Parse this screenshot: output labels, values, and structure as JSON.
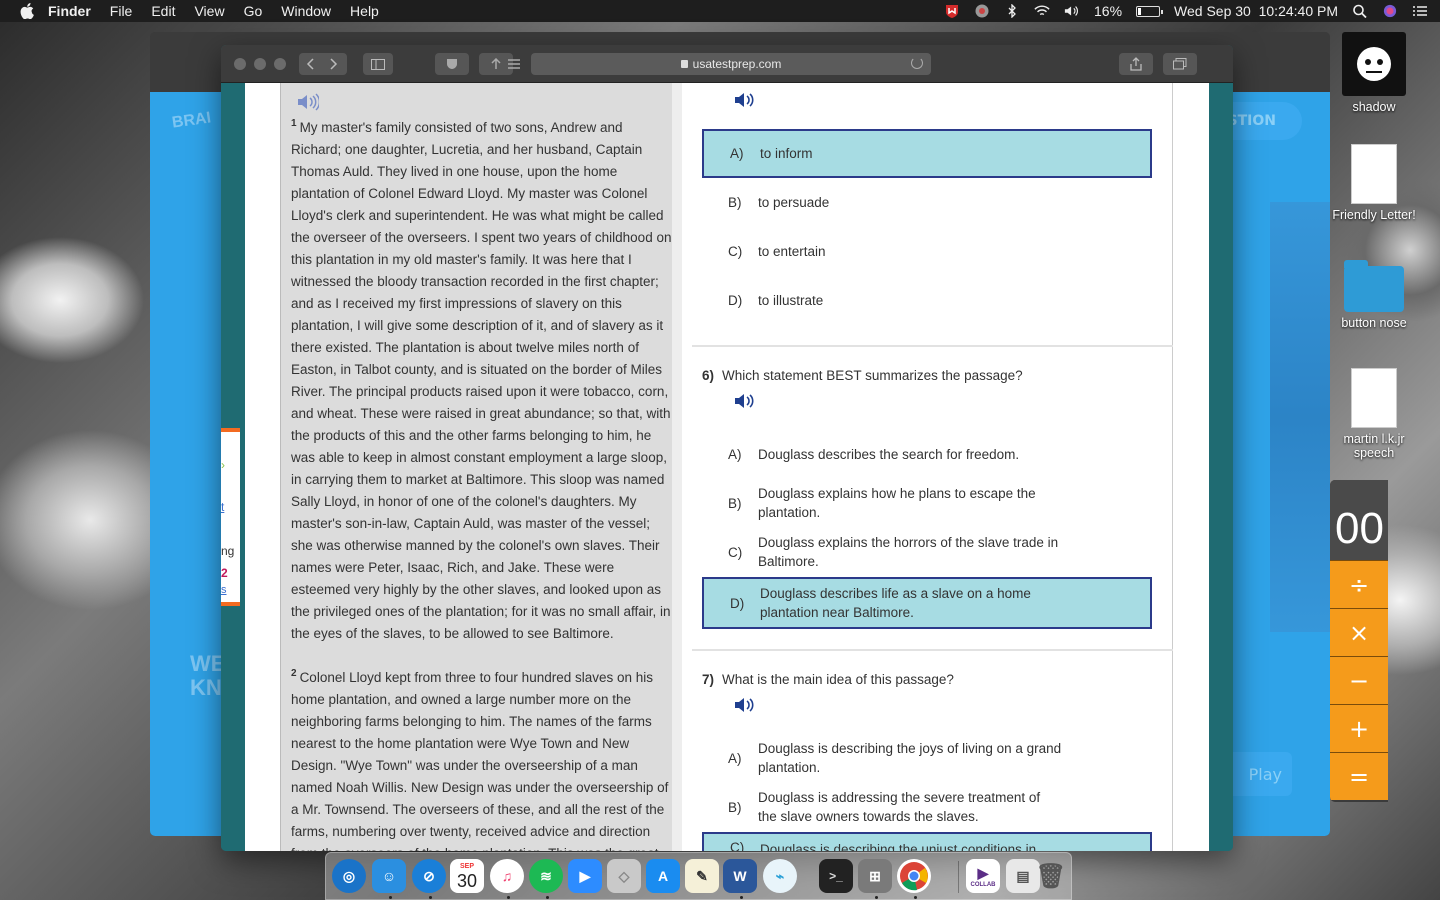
{
  "menubar": {
    "app_name": "Finder",
    "items": [
      "File",
      "Edit",
      "View",
      "Go",
      "Window",
      "Help"
    ],
    "battery_percent": "16%",
    "battery_level": 0.16,
    "datetime": "Wed Sep 30  10:24:40 PM"
  },
  "browser": {
    "url": "usatestprep.com"
  },
  "back_page": {
    "brand": "BRAI",
    "question_button": "ESTION",
    "wk_text": "WE\nKN",
    "play_text": "Play"
  },
  "side_tab": {
    "lines": [
      "ng",
      "2",
      "s"
    ]
  },
  "passage": {
    "paragraphs": [
      {
        "num": "1",
        "text": "My master's family consisted of two sons, Andrew and Richard; one daughter, Lucretia, and her husband, Captain Thomas Auld. They lived in one house, upon the home plantation of Colonel Edward Lloyd. My master was Colonel Lloyd's clerk and superintendent. He was what might be called the overseer of the overseers. I spent two years of childhood on this plantation in my old master's family. It was here that I witnessed the bloody transaction recorded in the first chapter; and as I received my first impressions of slavery on this plantation, I will give some description of it, and of slavery as it there existed. The plantation is about twelve miles north of Easton, in Talbot county, and is situated on the border of Miles River. The principal products raised upon it were tobacco, corn, and wheat. These were raised in great abundance; so that, with the products of this and the other farms belonging to him, he was able to keep in almost constant employment a large sloop, in carrying them to market at Baltimore. This sloop was named Sally Lloyd, in honor of one of the colonel's daughters. My master's son-in-law, Captain Auld, was master of the vessel; she was otherwise manned by the colonel's own slaves. Their names were Peter, Isaac, Rich, and Jake. These were esteemed very highly by the other slaves, and looked upon as the privileged ones of the plantation; for it was no small affair, in the eyes of the slaves, to be allowed to see Baltimore."
      },
      {
        "num": "2",
        "text": "Colonel Lloyd kept from three to four hundred slaves on his home plantation, and owned a large number more on the neighboring farms belonging to him. The names of the farms nearest to the home plantation were Wye Town and New Design. \"Wye Town\" was under the overseership of a man named Noah Willis. New Design was under the overseership of a Mr. Townsend. The overseers of these, and all the rest of the farms, numbering over twenty, received advice and direction from the overseers of the home plantation. This was the great"
      }
    ]
  },
  "questions": {
    "q5": {
      "options": [
        {
          "letter": "A)",
          "text": "to inform",
          "selected": true
        },
        {
          "letter": "B)",
          "text": "to persuade",
          "selected": false
        },
        {
          "letter": "C)",
          "text": "to entertain",
          "selected": false
        },
        {
          "letter": "D)",
          "text": "to illustrate",
          "selected": false
        }
      ]
    },
    "q6": {
      "number": "6)",
      "prompt": "Which statement BEST summarizes the passage?",
      "options": [
        {
          "letter": "A)",
          "text": "Douglass describes the search for freedom.",
          "selected": false
        },
        {
          "letter": "B)",
          "text": "Douglass explains how he plans to escape the plantation.",
          "selected": false
        },
        {
          "letter": "C)",
          "text": "Douglass explains the horrors of the slave trade in Baltimore.",
          "selected": false
        },
        {
          "letter": "D)",
          "text": "Douglass describes life as a slave on a home plantation near Baltimore.",
          "selected": true
        }
      ]
    },
    "q7": {
      "number": "7)",
      "prompt": "What is the main idea of this passage?",
      "options": [
        {
          "letter": "A)",
          "text": "Douglass is describing the joys of living on a grand plantation.",
          "selected": false
        },
        {
          "letter": "B)",
          "text": "Douglass is addressing the severe treatment of the slave owners towards the slaves.",
          "selected": false
        },
        {
          "letter": "C)",
          "text": "Douglass is describing the unjust conditions in which",
          "selected": true
        }
      ]
    }
  },
  "desktop": {
    "items": [
      {
        "label": "shadow",
        "icon": "image-icon"
      },
      {
        "label": "Friendly Letter!",
        "icon": "document-icon"
      },
      {
        "label": "button nose",
        "icon": "folder-icon"
      },
      {
        "label": "martin l.k.jr speech",
        "icon": "document-icon"
      }
    ]
  },
  "calculator": {
    "display": "00",
    "keys": [
      "÷",
      "×",
      "−",
      "+",
      "="
    ]
  },
  "dock": {
    "calendar_month": "SEP",
    "calendar_day": "30",
    "word_letter": "W",
    "collab_label": "COLLAB"
  },
  "colors": {
    "selected_fill": "#a7dce3",
    "selected_border": "#2b3a8a",
    "page_teal": "#1f6b72",
    "back_blue": "#2fa3e8",
    "calc_orange": "#f59b1b"
  }
}
